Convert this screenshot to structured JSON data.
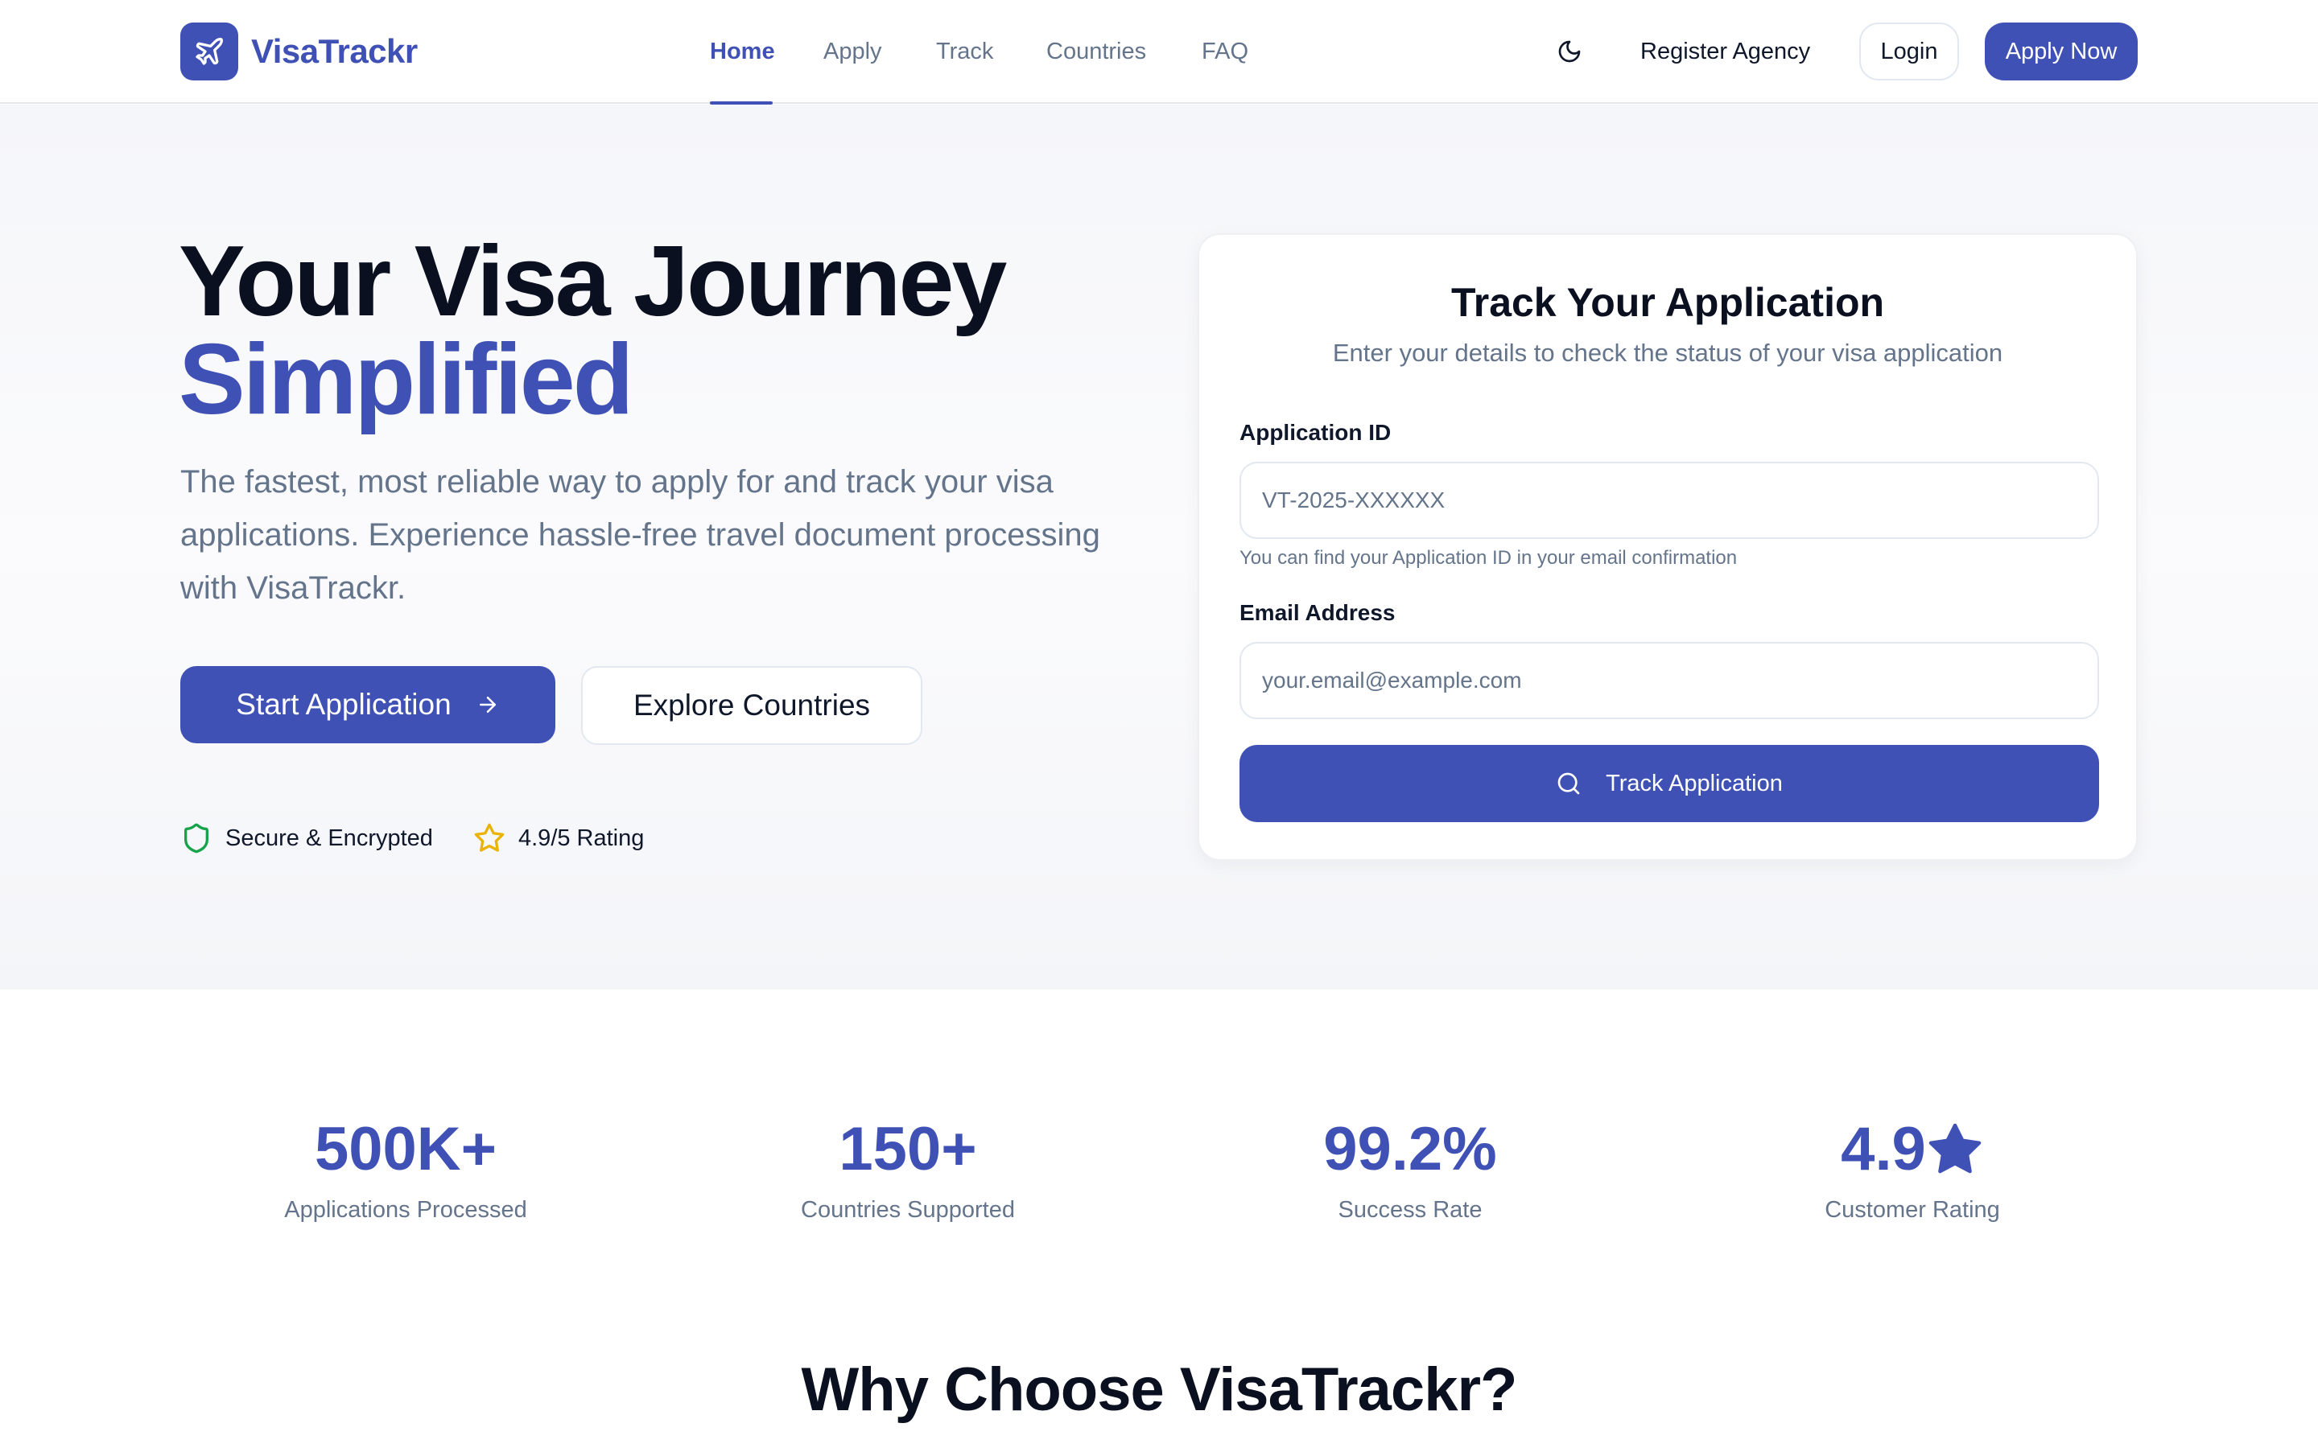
{
  "brand": {
    "name": "VisaTrackr",
    "color": "#3f51b5"
  },
  "nav": {
    "items": [
      {
        "label": "Home",
        "active": true
      },
      {
        "label": "Apply",
        "active": false
      },
      {
        "label": "Track",
        "active": false
      },
      {
        "label": "Countries",
        "active": false
      },
      {
        "label": "FAQ",
        "active": false
      }
    ],
    "theme_icon": "moon-icon",
    "register_label": "Register Agency",
    "login_label": "Login",
    "apply_now_label": "Apply Now"
  },
  "hero": {
    "title_line1": "Your Visa Journey",
    "title_line2": "Simplified",
    "description": "The fastest, most reliable way to apply for and track your visa applications. Experience hassle-free travel document processing with VisaTrackr.",
    "start_label": "Start Application",
    "explore_label": "Explore Countries",
    "badges": [
      {
        "icon": "shield-icon",
        "label": "Secure & Encrypted",
        "color": "#16a34a"
      },
      {
        "icon": "star-icon",
        "label": "4.9/5 Rating",
        "color": "#eab308"
      }
    ]
  },
  "track": {
    "title": "Track Your Application",
    "subtitle": "Enter your details to check the status of your visa application",
    "app_id_label": "Application ID",
    "app_id_placeholder": "VT-2025-XXXXXX",
    "app_id_value": "",
    "app_id_hint": "You can find your Application ID in your email confirmation",
    "email_label": "Email Address",
    "email_placeholder": "your.email@example.com",
    "email_value": "",
    "button_label": "Track Application"
  },
  "stats": [
    {
      "value": "500K+",
      "label": "Applications Processed"
    },
    {
      "value": "150+",
      "label": "Countries Supported"
    },
    {
      "value": "99.2%",
      "label": "Success Rate"
    },
    {
      "value": "4.9",
      "label": "Customer Rating",
      "icon": "star-icon"
    }
  ],
  "why": {
    "title": "Why Choose VisaTrackr?"
  }
}
